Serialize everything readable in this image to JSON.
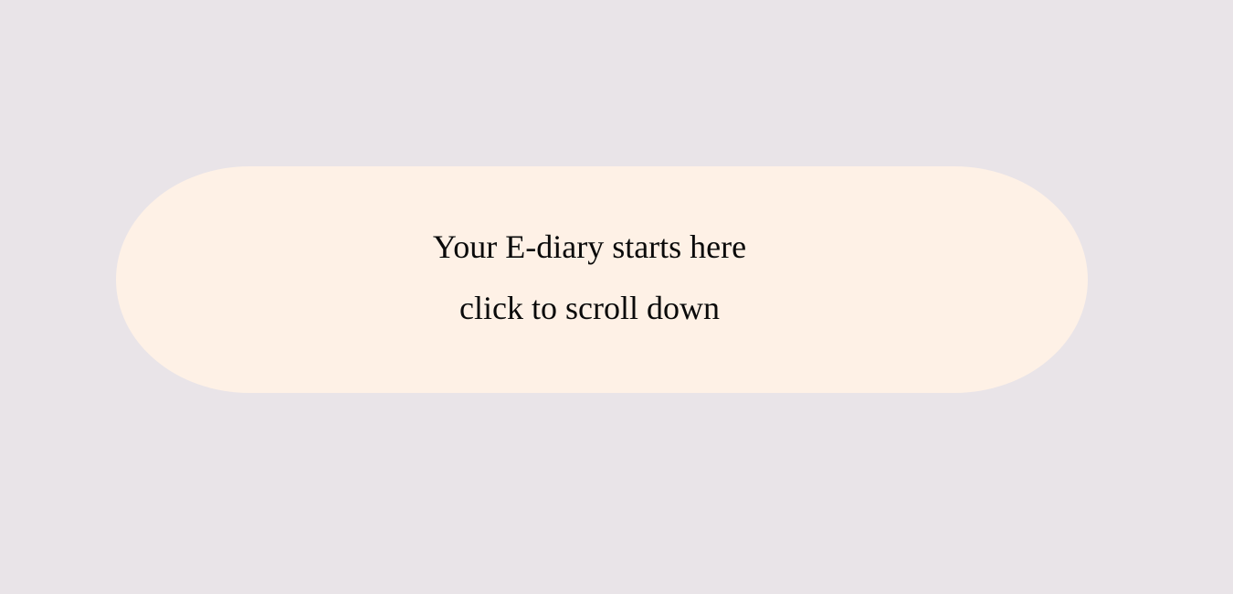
{
  "background_color": "#e9e4e8",
  "pill_color": "#fef1e6",
  "text_color": "#0a0a0a",
  "hero": {
    "heading": "Your E-diary starts here",
    "scroll_hint": "click to scroll down"
  }
}
